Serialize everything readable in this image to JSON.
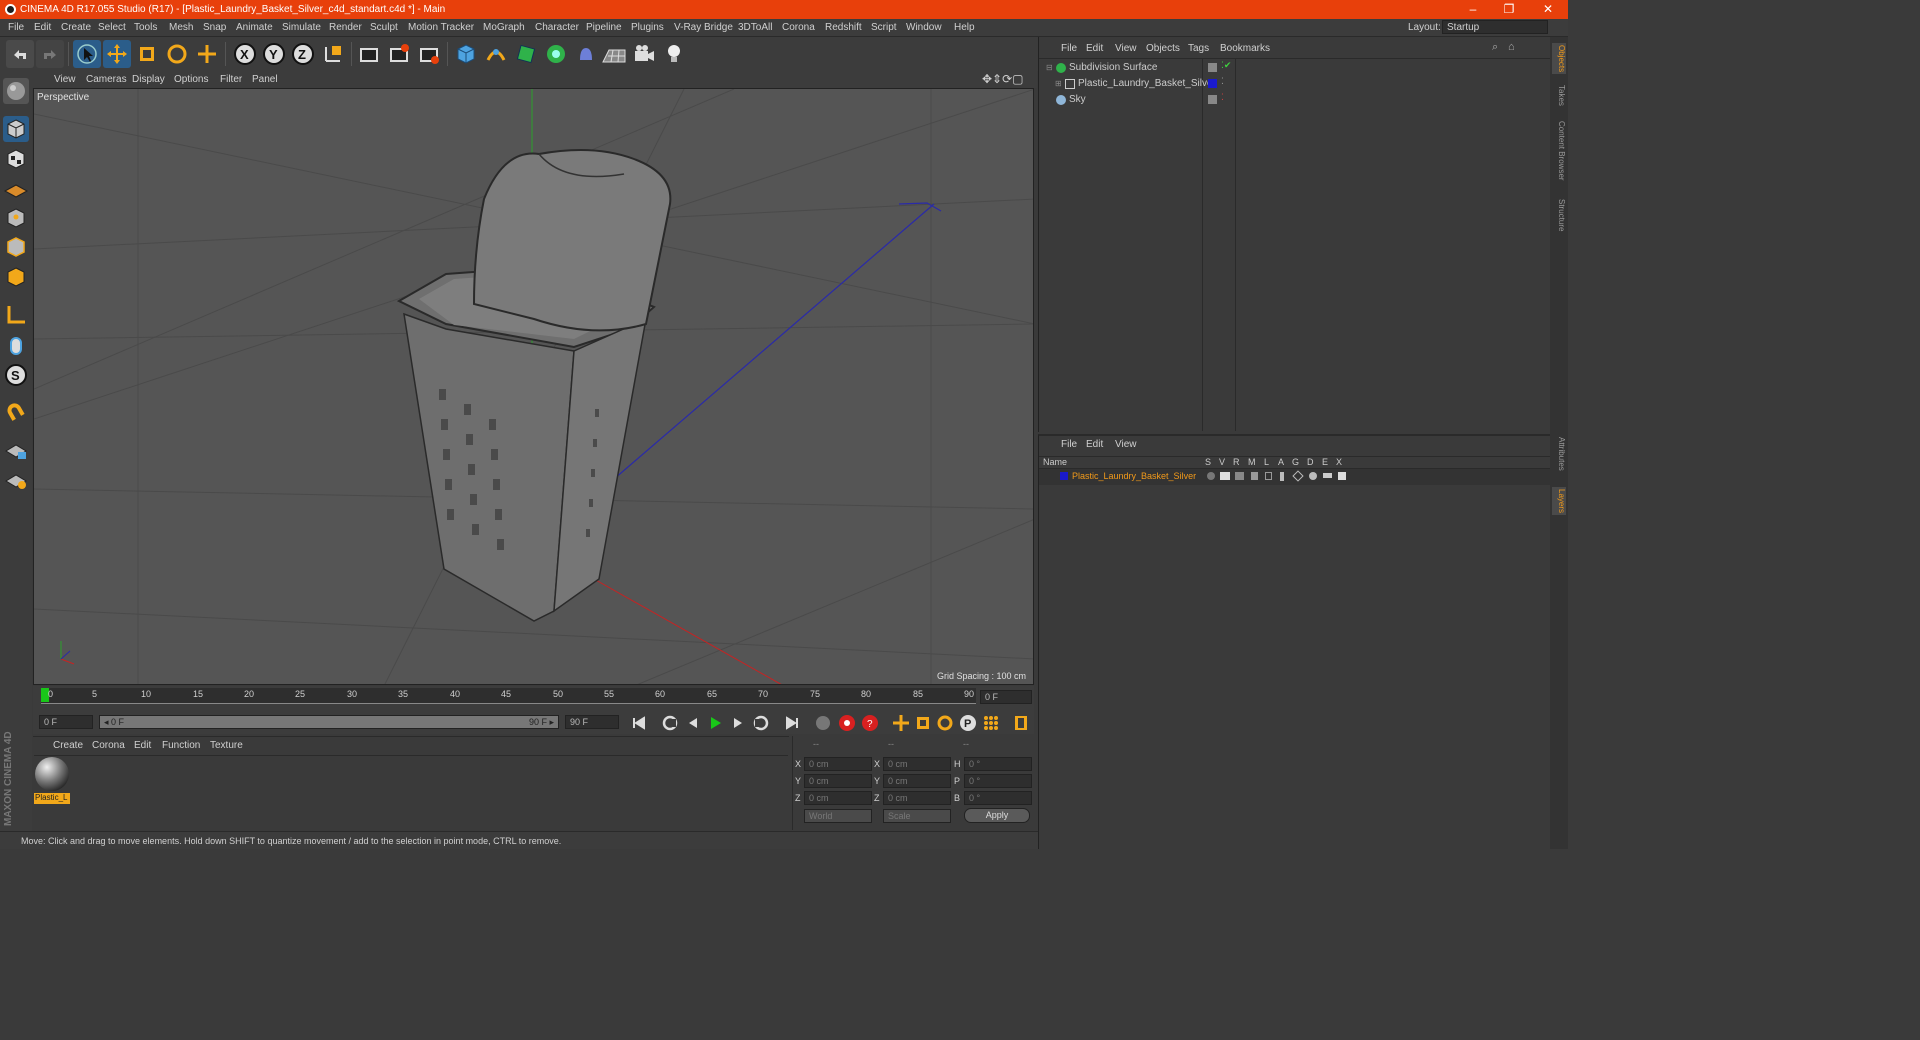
{
  "window": {
    "title": "CINEMA 4D R17.055 Studio (R17) - [Plastic_Laundry_Basket_Silver_c4d_standart.c4d *] - Main",
    "controls": [
      "–",
      "❐",
      "✕"
    ]
  },
  "menubar": {
    "items": [
      "File",
      "Edit",
      "Create",
      "Select",
      "Tools",
      "Mesh",
      "Snap",
      "Animate",
      "Simulate",
      "Render",
      "Sculpt",
      "Motion Tracker",
      "MoGraph",
      "Character",
      "Pipeline",
      "Plugins",
      "V-Ray Bridge",
      "3DToAll",
      "Corona",
      "Redshift",
      "Script",
      "Window",
      "Help"
    ],
    "layout_label": "Layout:",
    "layout_value": "Startup"
  },
  "viewport": {
    "menu": [
      "View",
      "Cameras",
      "Display",
      "Options",
      "Filter",
      "Panel"
    ],
    "name": "Perspective",
    "grid_spacing": "Grid Spacing : 100 cm"
  },
  "timeline": {
    "ticks": [
      "0",
      "5",
      "10",
      "15",
      "20",
      "25",
      "30",
      "35",
      "40",
      "45",
      "50",
      "55",
      "60",
      "65",
      "70",
      "75",
      "80",
      "85",
      "90"
    ],
    "current_frame": "0 F"
  },
  "transport": {
    "start": "0 F",
    "range_start": "◂ 0 F",
    "range_end": "90 F ▸",
    "end": "90 F"
  },
  "material_manager": {
    "menu": [
      "Create",
      "Corona",
      "Edit",
      "Function",
      "Texture"
    ],
    "material_name": "Plastic_L"
  },
  "coordinates": {
    "headers": [
      "--",
      "--",
      "--"
    ],
    "rows": [
      {
        "a": "X",
        "av": "0 cm",
        "b": "X",
        "bv": "0 cm",
        "c": "H",
        "cv": "0 °"
      },
      {
        "a": "Y",
        "av": "0 cm",
        "b": "Y",
        "bv": "0 cm",
        "c": "P",
        "cv": "0 °"
      },
      {
        "a": "Z",
        "av": "0 cm",
        "b": "Z",
        "bv": "0 cm",
        "c": "B",
        "cv": "0 °"
      }
    ],
    "mode1": "World",
    "mode2": "Scale",
    "apply": "Apply"
  },
  "object_manager": {
    "menu": [
      "File",
      "Edit",
      "View",
      "Objects",
      "Tags",
      "Bookmarks"
    ],
    "objects": [
      {
        "name": "Subdivision Surface",
        "indent": 0
      },
      {
        "name": "Plastic_Laundry_Basket_Silver",
        "indent": 1
      },
      {
        "name": "Sky",
        "indent": 0
      }
    ]
  },
  "layer_manager": {
    "menu": [
      "File",
      "Edit",
      "View"
    ],
    "columns": [
      "Name",
      "S",
      "V",
      "R",
      "M",
      "L",
      "A",
      "G",
      "D",
      "E",
      "X"
    ],
    "layers": [
      {
        "name": "Plastic_Laundry_Basket_Silver",
        "color": "#1a1acc"
      }
    ]
  },
  "right_tabs": [
    "Objects",
    "Takes",
    "Content Browser",
    "Structure",
    "Attributes",
    "Layers"
  ],
  "status": "Move: Click and drag to move elements. Hold down SHIFT to quantize movement / add to the selection in point mode, CTRL to remove.",
  "brand": "MAXON CINEMA 4D",
  "colors": {
    "titlebar": "#e8400b",
    "accent_blue": "#3a8fd8",
    "accent_orange": "#f29a1a"
  }
}
